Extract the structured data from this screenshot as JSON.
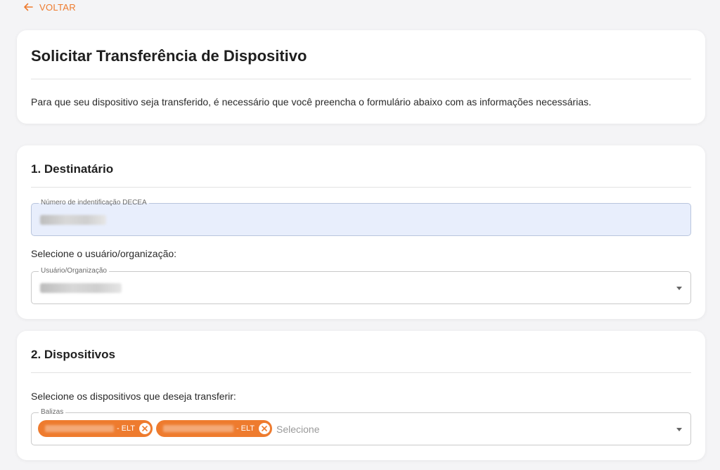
{
  "back": {
    "label": "VOLTAR"
  },
  "header": {
    "title": "Solicitar Transferência de Dispositivo",
    "description": "Para que seu dispositivo seja transferido, é necessário que você preencha o formulário abaixo com as informações necessárias."
  },
  "destinatario": {
    "heading": "1. Destinatário",
    "id_field": {
      "label": "Número de indentificação DECEA",
      "value": ""
    },
    "select_prompt": "Selecione o usuário/organização:",
    "user_field": {
      "label": "Usuário/Organização",
      "value": ""
    }
  },
  "dispositivos": {
    "heading": "2. Dispositivos",
    "prompt": "Selecione os dispositivos que deseja transferir:",
    "balizas_field": {
      "label": "Balizas",
      "chips": [
        {
          "suffix": "- ELT"
        },
        {
          "suffix": "- ELT"
        }
      ],
      "placeholder": "Selecione"
    }
  },
  "colors": {
    "accent": "#ee7b2e",
    "background": "#f4f4f6",
    "filled_input": "#e8eefc"
  },
  "icons": {
    "back": "arrow-left-icon",
    "dropdown": "caret-down-icon",
    "chip_remove": "close-circle-icon"
  }
}
